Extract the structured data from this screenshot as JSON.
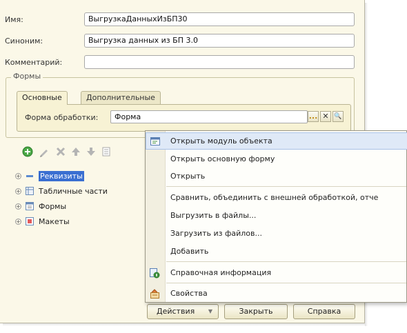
{
  "form": {
    "name_label": "Имя:",
    "name_value": "ВыгрузкаДанныхИзБП30",
    "synonym_label": "Синоним:",
    "synonym_value": "Выгрузка данных из БП 3.0",
    "comment_label": "Комментарий:",
    "comment_value": ""
  },
  "forms_group": {
    "title": "Формы",
    "tabs": [
      {
        "label": "Основные",
        "active": true
      },
      {
        "label": "Дополнительные",
        "active": false
      }
    ],
    "form_label": "Форма обработки:",
    "form_value": "Форма",
    "ellipsis_label": "...",
    "clear_label": "✕",
    "search_label": "🔍"
  },
  "toolbar": {
    "icons": [
      "add-icon",
      "edit-icon",
      "delete-icon",
      "move-up-icon",
      "move-down-icon",
      "list-icon"
    ]
  },
  "tree": {
    "items": [
      {
        "label": "Реквизиты",
        "icon": "attributes-icon",
        "selected": true
      },
      {
        "label": "Табличные части",
        "icon": "table-icon",
        "selected": false
      },
      {
        "label": "Формы",
        "icon": "form-icon",
        "selected": false
      },
      {
        "label": "Макеты",
        "icon": "template-icon",
        "selected": false
      }
    ]
  },
  "context_menu": {
    "items": [
      {
        "label": "Открыть модуль объекта",
        "icon": "module-icon",
        "highlighted": true
      },
      {
        "label": "Открыть основную форму",
        "icon": "",
        "highlighted": false
      },
      {
        "label": "Открыть",
        "icon": "",
        "highlighted": false
      },
      {
        "label": "Сравнить, объединить с внешней обработкой, отче",
        "icon": "",
        "highlighted": false
      },
      {
        "label": "Выгрузить в файлы...",
        "icon": "",
        "highlighted": false
      },
      {
        "label": "Загрузить из файлов...",
        "icon": "",
        "highlighted": false
      },
      {
        "label": "Добавить",
        "icon": "",
        "highlighted": false
      },
      {
        "label": "Справочная информация",
        "icon": "help-info-icon",
        "highlighted": false
      },
      {
        "label": "Свойства",
        "icon": "properties-icon",
        "highlighted": false
      }
    ]
  },
  "buttons": {
    "actions_label": "Действия",
    "close_label": "Закрыть",
    "help_label": "Справка"
  },
  "colors": {
    "window_bg": "#fbf8e8",
    "selection": "#3a6fd1",
    "menu_highlight": "#dfe9f7"
  }
}
